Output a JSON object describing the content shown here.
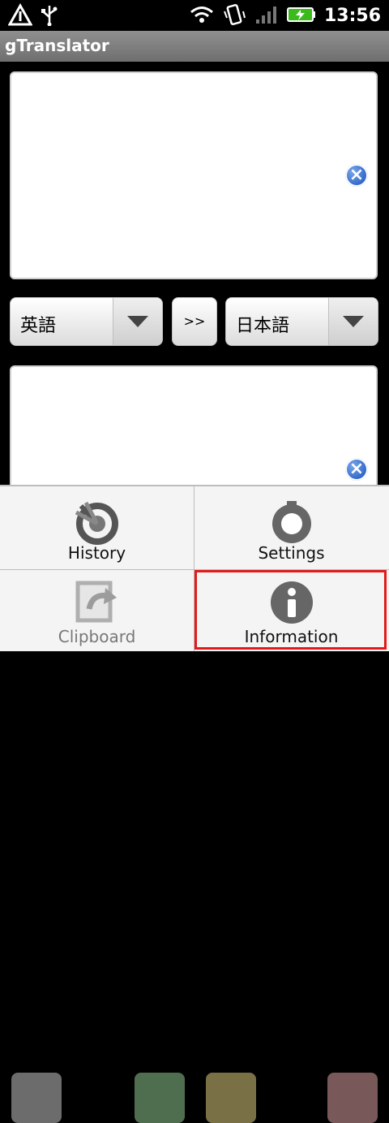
{
  "status_bar": {
    "time": "13:56",
    "icons": [
      "warning-icon",
      "usb-icon",
      "wifi-icon",
      "vibrate-icon",
      "signal-icon",
      "battery-icon"
    ]
  },
  "app": {
    "title": "gTranslator"
  },
  "languages": {
    "source": "英語",
    "target": "日本語",
    "swap_label": ">>"
  },
  "menu": {
    "items": [
      {
        "label": "History",
        "icon": "history-icon"
      },
      {
        "label": "Settings",
        "icon": "settings-icon"
      },
      {
        "label": "Clipboard",
        "icon": "clipboard-icon"
      },
      {
        "label": "Information",
        "icon": "information-icon"
      }
    ]
  },
  "colors": {
    "accent_blue": "#2c63c6",
    "title_bar": "#7f7f7f",
    "highlight": "#e11b1b"
  }
}
